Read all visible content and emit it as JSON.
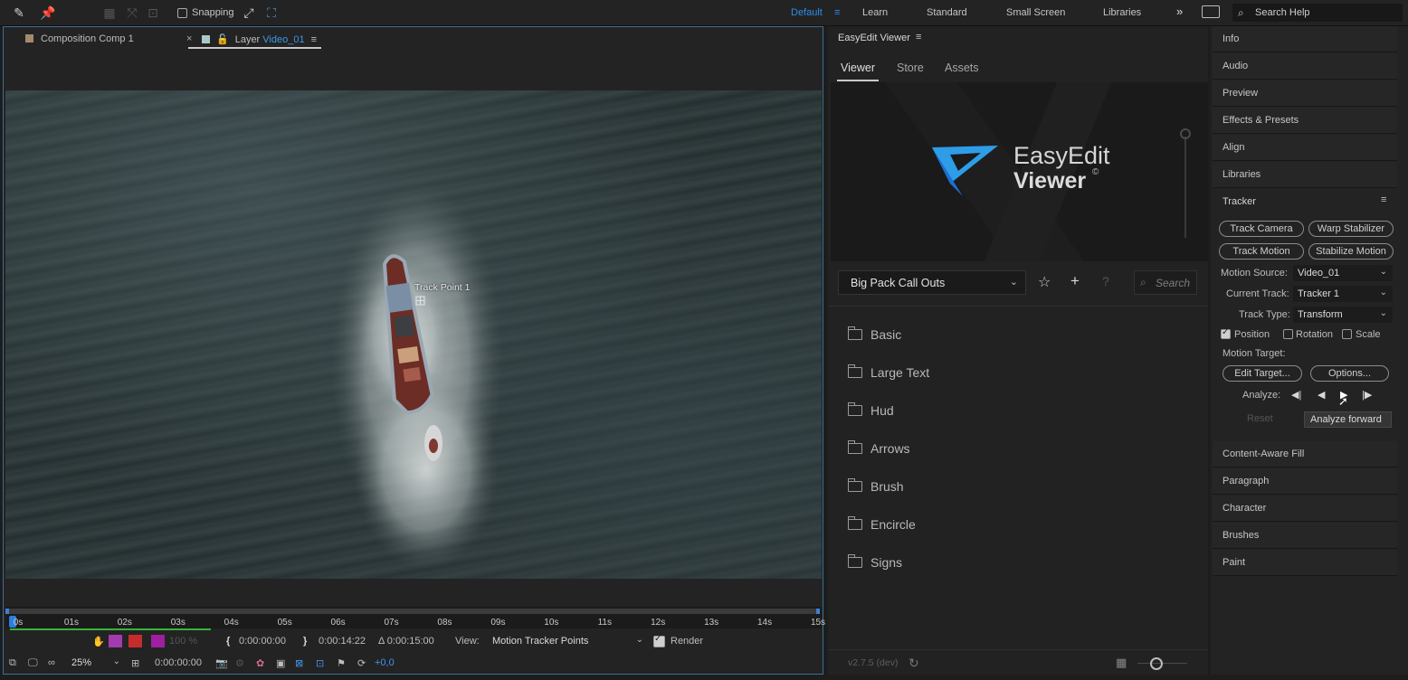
{
  "toolbar": {
    "snapping_label": "Snapping",
    "workspaces": [
      "Default",
      "Learn",
      "Standard",
      "Small Screen",
      "Libraries"
    ],
    "search_placeholder": "Search Help"
  },
  "comp_panel": {
    "tab_composition": "Composition Comp 1",
    "tab_layer_prefix": "Layer",
    "tab_layer_name": "Video_01",
    "track_point_label": "Track Point 1",
    "ruler_ticks": [
      "0s",
      "01s",
      "02s",
      "03s",
      "04s",
      "05s",
      "06s",
      "07s",
      "08s",
      "09s",
      "10s",
      "11s",
      "12s",
      "13s",
      "14s",
      "15s"
    ],
    "bar1": {
      "zoom_percent": "100 %",
      "in_time": "0:00:00:00",
      "out_time": "0:00:14:22",
      "duration": "Δ 0:00:15:00",
      "view_label": "View:",
      "view_value": "Motion Tracker Points",
      "render_label": "Render"
    },
    "bar2": {
      "zoom": "25%",
      "timecode": "0:00:00:00",
      "exposure": "+0,0"
    }
  },
  "easyedit": {
    "title": "EasyEdit Viewer",
    "tabs": [
      "Viewer",
      "Store",
      "Assets"
    ],
    "logo_line1": "EasyEdit",
    "logo_line2": "Viewer",
    "logo_mark": "©",
    "pack": "Big Pack Call Outs",
    "search_placeholder": "Search",
    "help_glyph": "?",
    "folders": [
      "Basic",
      "Large Text",
      "Hud",
      "Arrows",
      "Brush",
      "Encircle",
      "Signs"
    ],
    "version": "v2.7.5 (dev)"
  },
  "right_panel": {
    "sections_top": [
      "Info",
      "Audio",
      "Preview",
      "Effects & Presets",
      "Align",
      "Libraries"
    ],
    "tracker": {
      "title": "Tracker",
      "buttons": {
        "track_camera": "Track Camera",
        "warp_stabilizer": "Warp Stabilizer",
        "track_motion": "Track Motion",
        "stabilize_motion": "Stabilize Motion",
        "edit_target": "Edit Target...",
        "options": "Options...",
        "reset": "Reset"
      },
      "motion_source_label": "Motion Source:",
      "motion_source": "Video_01",
      "current_track_label": "Current Track:",
      "current_track": "Tracker 1",
      "track_type_label": "Track Type:",
      "track_type": "Transform",
      "position_label": "Position",
      "rotation_label": "Rotation",
      "scale_label": "Scale",
      "position_checked": true,
      "rotation_checked": false,
      "scale_checked": false,
      "motion_target_label": "Motion Target:",
      "analyze_label": "Analyze:",
      "tooltip": "Analyze forward"
    },
    "sections_bottom": [
      "Content-Aware Fill",
      "Paragraph",
      "Character",
      "Brushes",
      "Paint"
    ]
  }
}
